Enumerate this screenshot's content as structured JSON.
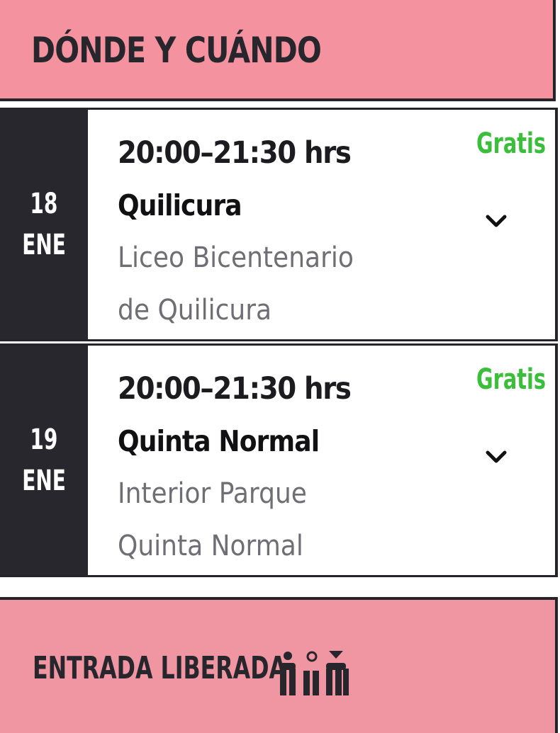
{
  "header": {
    "title": "DÓNDE Y CUÁNDO"
  },
  "events": [
    {
      "day": "18",
      "month": "ENE",
      "time": "20:00–21:30 hrs",
      "location": "Quilicura",
      "venue_line1": "Liceo Bicentenario",
      "venue_line2": "de Quilicura",
      "price": "Gratis",
      "expand_icon": "chevron-down-icon"
    },
    {
      "day": "19",
      "month": "ENE",
      "time": "20:00–21:30 hrs",
      "location": "Quinta Normal",
      "venue_line1": "Interior Parque",
      "venue_line2": "Quinta Normal",
      "price": "Gratis",
      "expand_icon": "chevron-down-icon"
    }
  ],
  "footer": {
    "label": "ENTRADA LIBERADA",
    "icon": "family-icon"
  },
  "colors": {
    "header_bg": "#f4929f",
    "footer_bg": "#f096a2",
    "date_bg": "#27272d",
    "price": "#3bbf3b",
    "venue_text": "#6f6e75",
    "border": "#24242a"
  }
}
